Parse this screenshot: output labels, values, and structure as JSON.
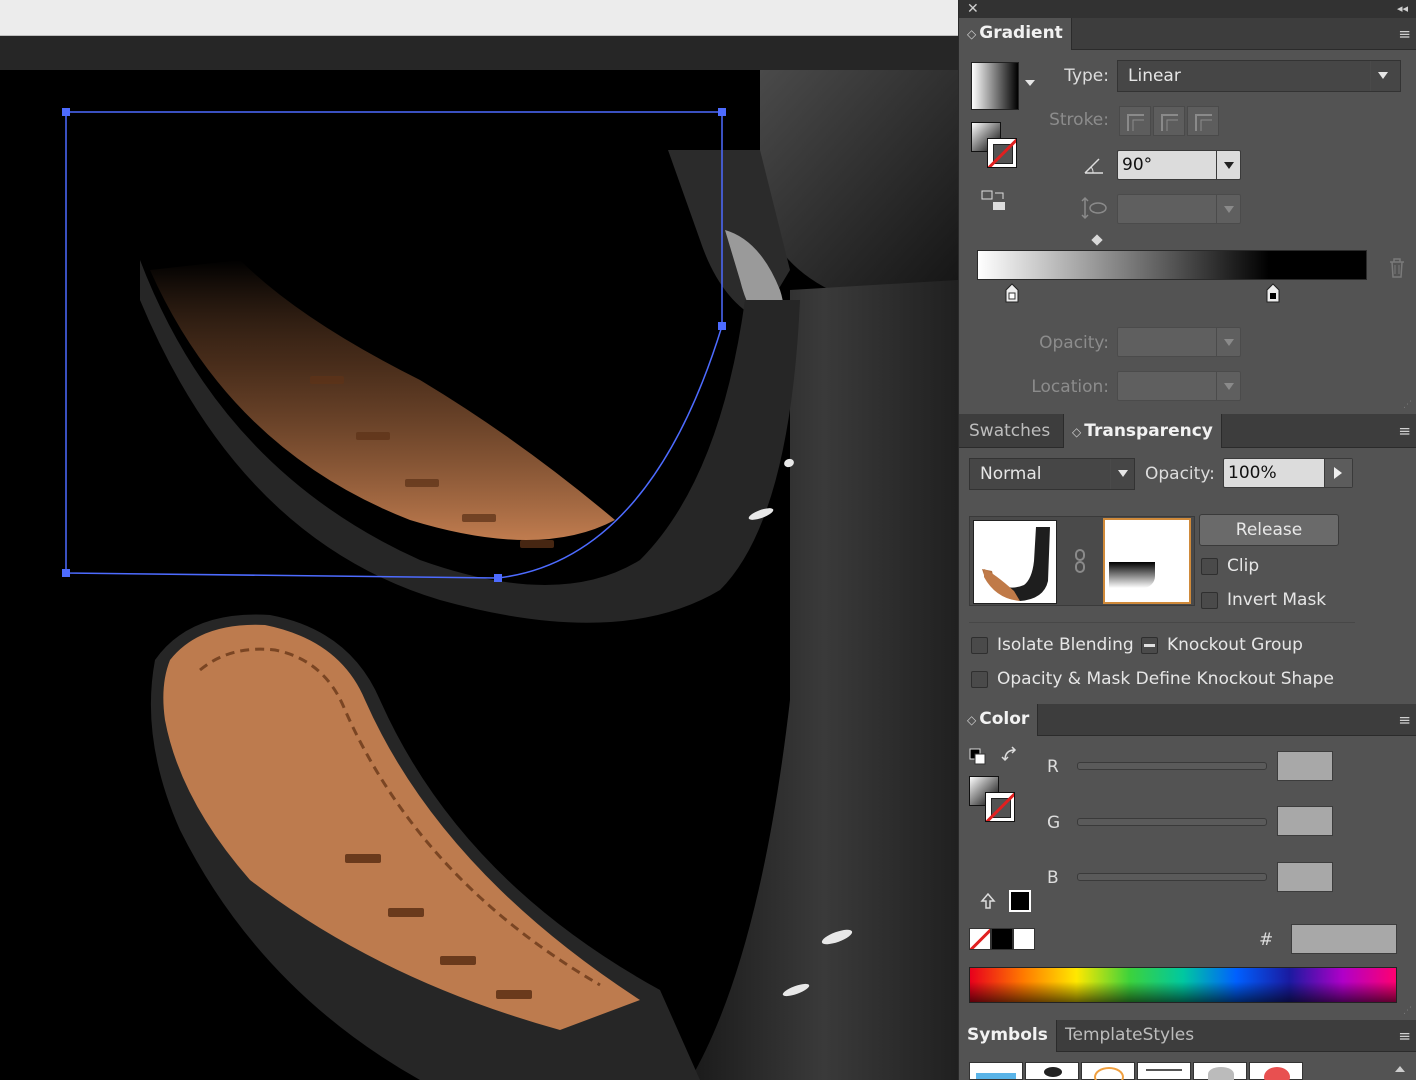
{
  "gradient_panel": {
    "tab": "Gradient",
    "type_label": "Type:",
    "type_value": "Linear",
    "stroke_label": "Stroke:",
    "angle_value": "90°",
    "opacity_label": "Opacity:",
    "location_label": "Location:"
  },
  "transparency_panel": {
    "tabs": [
      "Swatches",
      "Transparency"
    ],
    "blend_mode": "Normal",
    "opacity_label": "Opacity:",
    "opacity_value": "100%",
    "release_label": "Release",
    "clip_label": "Clip",
    "invert_mask_label": "Invert Mask",
    "isolate_blending_label": "Isolate Blending",
    "knockout_group_label": "Knockout Group",
    "opacity_mask_label": "Opacity & Mask Define Knockout Shape"
  },
  "color_panel": {
    "tab": "Color",
    "r_label": "R",
    "g_label": "G",
    "b_label": "B",
    "hex_label": "#"
  },
  "symbols_panel": {
    "tabs": [
      "Symbols",
      "TemplateStyles"
    ]
  },
  "colors": {
    "panel_bg": "#535353",
    "selection": "#4d6bff",
    "leather": "#b8764a"
  }
}
